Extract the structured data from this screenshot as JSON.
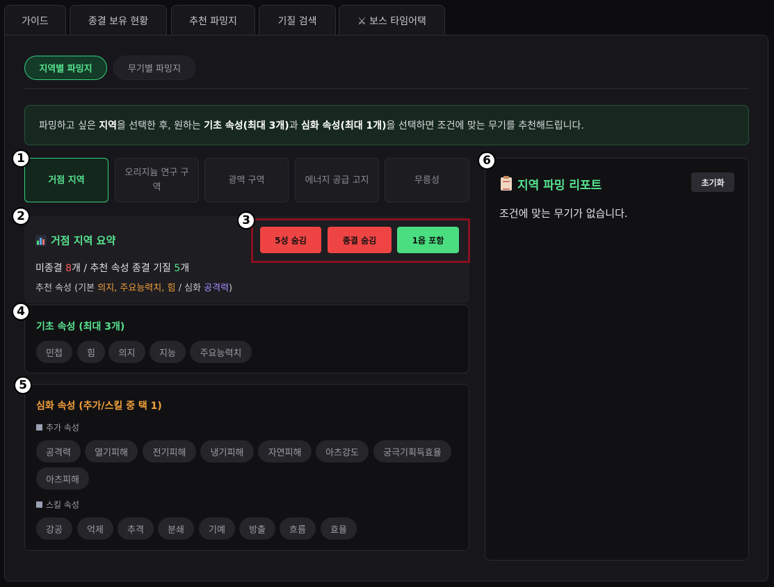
{
  "tabs": [
    {
      "label": "가이드"
    },
    {
      "label": "종결 보유 현황"
    },
    {
      "label": "추천 파밍지"
    },
    {
      "label": "기질 검색"
    },
    {
      "label": "⚔ 보스 타임어택"
    }
  ],
  "subtabs": [
    {
      "label": "지역별 파밍지",
      "active": true
    },
    {
      "label": "무기별 파밍지",
      "active": false
    }
  ],
  "info": {
    "t1": "파밍하고 싶은 ",
    "b1": "지역",
    "t2": "을 선택한 후, 원하는 ",
    "b2": "기초 속성(최대 3개)",
    "t3": "과 ",
    "b3": "심화 속성(최대 1개)",
    "t4": "을 선택하면 조건에 맞는 무기를 추천해드립니다."
  },
  "regions": [
    {
      "label": "거점 지역",
      "active": true
    },
    {
      "label": "오리지늄 연구 구역",
      "active": false
    },
    {
      "label": "광맥 구역",
      "active": false
    },
    {
      "label": "에너지 공급 고지",
      "active": false
    },
    {
      "label": "무릉성",
      "active": false
    }
  ],
  "summary": {
    "title": "거점 지역 요약",
    "icon": "bar-chart-icon",
    "unfinished_label": "미종결 ",
    "unfinished_count": "8",
    "unit1": "개 / 추천 속성 종결 기질 ",
    "finished_count": "5",
    "unit2": "개",
    "rec_prefix": "추천 속성 (기본 ",
    "rec_basic": "의지, 주요능력치, 힘",
    "rec_mid": " / 심화 ",
    "rec_adv": "공격력",
    "rec_suffix": ")"
  },
  "filters": [
    {
      "label": "5성 숨김",
      "color": "#ef4444"
    },
    {
      "label": "종결 숨김",
      "color": "#ef4444"
    },
    {
      "label": "1옵 포함",
      "color": "#4ade80"
    }
  ],
  "basic": {
    "title": "기초 속성 (최대 3개)",
    "chips": [
      "민첩",
      "힘",
      "의지",
      "지능",
      "주요능력치"
    ]
  },
  "advanced": {
    "title": "심화 속성 (추가/스킬 중 택 1)",
    "extra_label": "추가 속성",
    "extra_chips": [
      "공격력",
      "열기피해",
      "전기피해",
      "냉기피해",
      "자연피해",
      "아츠강도",
      "궁극기획득효율",
      "아츠피해"
    ],
    "skill_label": "스킬 속성",
    "skill_chips": [
      "강공",
      "억제",
      "추격",
      "분쇄",
      "기예",
      "방출",
      "흐름",
      "효율"
    ]
  },
  "report": {
    "title": "지역 파밍 리포트",
    "icon": "clipboard-icon",
    "reset_label": "초기화",
    "empty_text": "조건에 맞는 무기가 없습니다."
  },
  "markers": [
    "1",
    "2",
    "3",
    "4",
    "5",
    "6"
  ],
  "colors": {
    "accent_green": "#57e38f",
    "danger": "#ef4444",
    "orange": "#f2a03a",
    "purple": "#a78bfa"
  }
}
